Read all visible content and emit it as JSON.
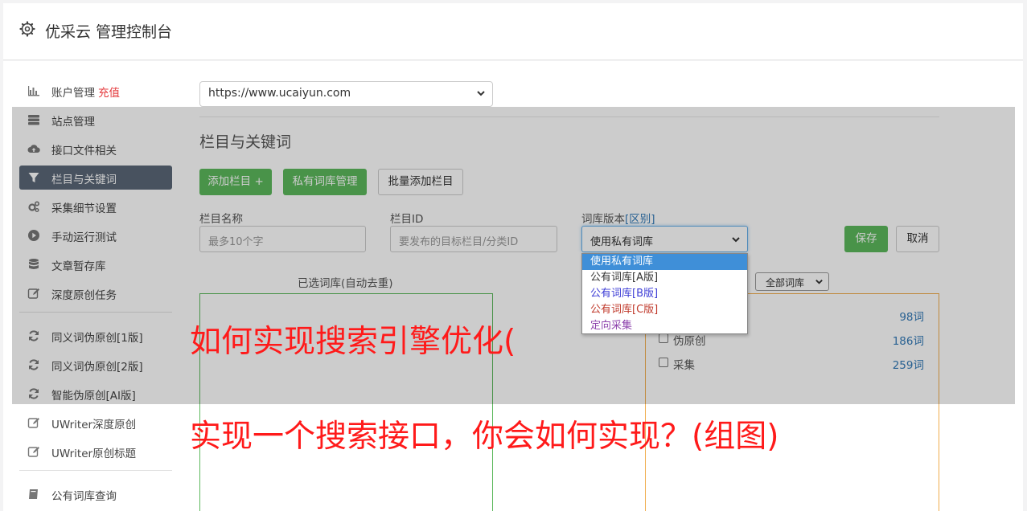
{
  "header": {
    "title": "优采云 管理控制台",
    "icon": "gear-icon"
  },
  "sidebar": {
    "group1": [
      {
        "label": "账户管理",
        "badge": "充值",
        "icon": "bar-chart-icon"
      },
      {
        "label": "站点管理",
        "icon": "server-icon"
      },
      {
        "label": "接口文件相关",
        "icon": "cloud-upload-icon"
      },
      {
        "label": "栏目与关键词",
        "icon": "filter-icon",
        "active": true
      },
      {
        "label": "采集细节设置",
        "icon": "gears-icon"
      },
      {
        "label": "手动运行测试",
        "icon": "play-circle-icon"
      },
      {
        "label": "文章暂存库",
        "icon": "database-icon"
      },
      {
        "label": "深度原创任务",
        "icon": "edit-icon"
      }
    ],
    "group2": [
      {
        "label": "同义词伪原创[1版]",
        "icon": "refresh-icon"
      },
      {
        "label": "同义词伪原创[2版]",
        "icon": "refresh-icon"
      },
      {
        "label": "智能伪原创[AI版]",
        "icon": "refresh-icon"
      },
      {
        "label": "UWriter深度原创",
        "icon": "edit-icon"
      },
      {
        "label": "UWriter原创标题",
        "icon": "edit-icon"
      }
    ],
    "group3": [
      {
        "label": "公有词库查询",
        "icon": "book-icon"
      }
    ]
  },
  "site_select": {
    "value": "https://www.ucaiyun.com"
  },
  "panel": {
    "title": "栏目与关键词",
    "buttons": {
      "add_column": "添加栏目 +",
      "private_lib": "私有词库管理",
      "batch_add": "批量添加栏目"
    },
    "fields": {
      "column_name": {
        "label": "栏目名称",
        "placeholder": "最多10个字"
      },
      "column_id": {
        "label": "栏目ID",
        "placeholder": "要发布的目标栏目/分类ID"
      },
      "lib_version": {
        "label": "词库版本",
        "link": "[区别]",
        "value": "使用私有词库"
      }
    },
    "save": "保存",
    "cancel": "取消",
    "selected_label": "已选词库(自动去重)",
    "filter": {
      "value": "全部词库"
    },
    "libs": [
      {
        "name": "",
        "count": "98词"
      },
      {
        "name": "伪原创",
        "count": "186词"
      },
      {
        "name": "采集",
        "count": "259词"
      }
    ]
  },
  "dropdown": {
    "options": [
      {
        "label": "使用私有词库",
        "selected": true,
        "color": "#ffffff"
      },
      {
        "label": "公有词库[A版]",
        "color": "#333333"
      },
      {
        "label": "公有词库[B版]",
        "color": "#3d3dd6"
      },
      {
        "label": "公有词库[C版]",
        "color": "#c0392b"
      },
      {
        "label": "定向采集",
        "color": "#8e44ad"
      }
    ]
  },
  "overlay_captions": {
    "line1": "如何实现搜索引擎优化(",
    "line2": "实现一个搜索接口，你会如何实现？(组图)"
  },
  "colors": {
    "accent_green": "#5cb85c",
    "active_nav": "#5b6777",
    "caption_red": "#ff1a1a",
    "link_blue": "#337ab7"
  }
}
